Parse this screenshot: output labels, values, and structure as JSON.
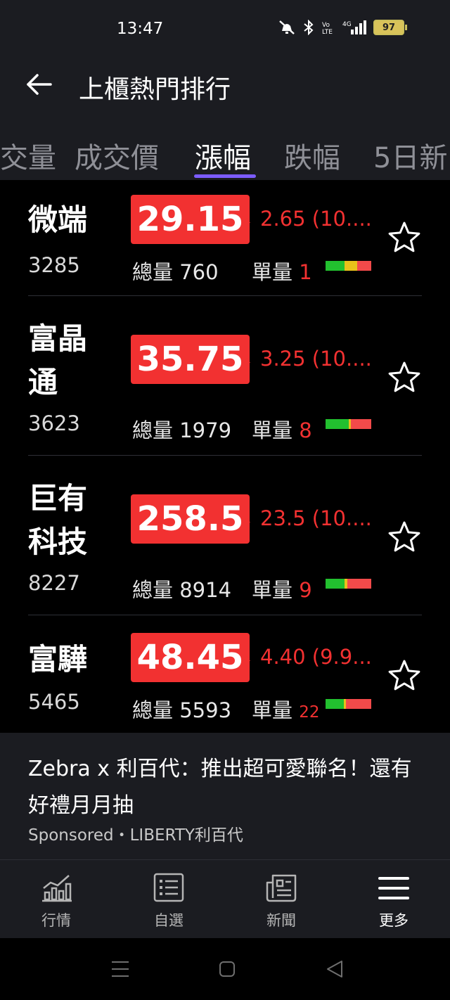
{
  "status_bar": {
    "time": "13:47",
    "battery": "97"
  },
  "header": {
    "title": "上櫃熱門排行"
  },
  "tabs": [
    {
      "label": "成交量"
    },
    {
      "label": "成交價"
    },
    {
      "label": "漲幅"
    },
    {
      "label": "跌幅"
    },
    {
      "label": "5日新"
    }
  ],
  "active_tab": "漲幅",
  "labels": {
    "volume": "總量",
    "single": "單量"
  },
  "stocks": [
    {
      "name_line1": "微端",
      "name_line2": "",
      "code": "3285",
      "price": "29.15",
      "change": "2.65 (10....",
      "volume": "760",
      "single": "1",
      "bar": [
        0.42,
        0.28,
        0.3
      ]
    },
    {
      "name_line1": "富晶",
      "name_line2": "通",
      "code": "3623",
      "price": "35.75",
      "change": "3.25 (10....",
      "volume": "1979",
      "single": "8",
      "bar": [
        0.52,
        0.04,
        0.44
      ]
    },
    {
      "name_line1": "巨有",
      "name_line2": "科技",
      "code": "8227",
      "price": "258.5",
      "change": "23.5 (10....",
      "volume": "8914",
      "single": "9",
      "bar": [
        0.42,
        0.06,
        0.52
      ]
    },
    {
      "name_line1": "富驊",
      "name_line2": "",
      "code": "5465",
      "price": "48.45",
      "change": "4.40 (9.9...",
      "volume": "5593",
      "single": "22",
      "bar": [
        0.4,
        0.04,
        0.56
      ]
    }
  ],
  "colors": {
    "up": "#f23131",
    "buy": "#22c02f",
    "neutral": "#e8c11a",
    "sell": "#f24a4a",
    "accent": "#7c5cff"
  },
  "ad": {
    "headline": "Zebra x 利百代：推出超可愛聯名！還有好禮月月抽",
    "sponsor": "Sponsored・LIBERTY利百代"
  },
  "bottom_nav": [
    {
      "label": "行情",
      "icon": "chart-icon"
    },
    {
      "label": "自選",
      "icon": "list-icon"
    },
    {
      "label": "新聞",
      "icon": "news-icon"
    },
    {
      "label": "更多",
      "icon": "menu-icon"
    }
  ]
}
